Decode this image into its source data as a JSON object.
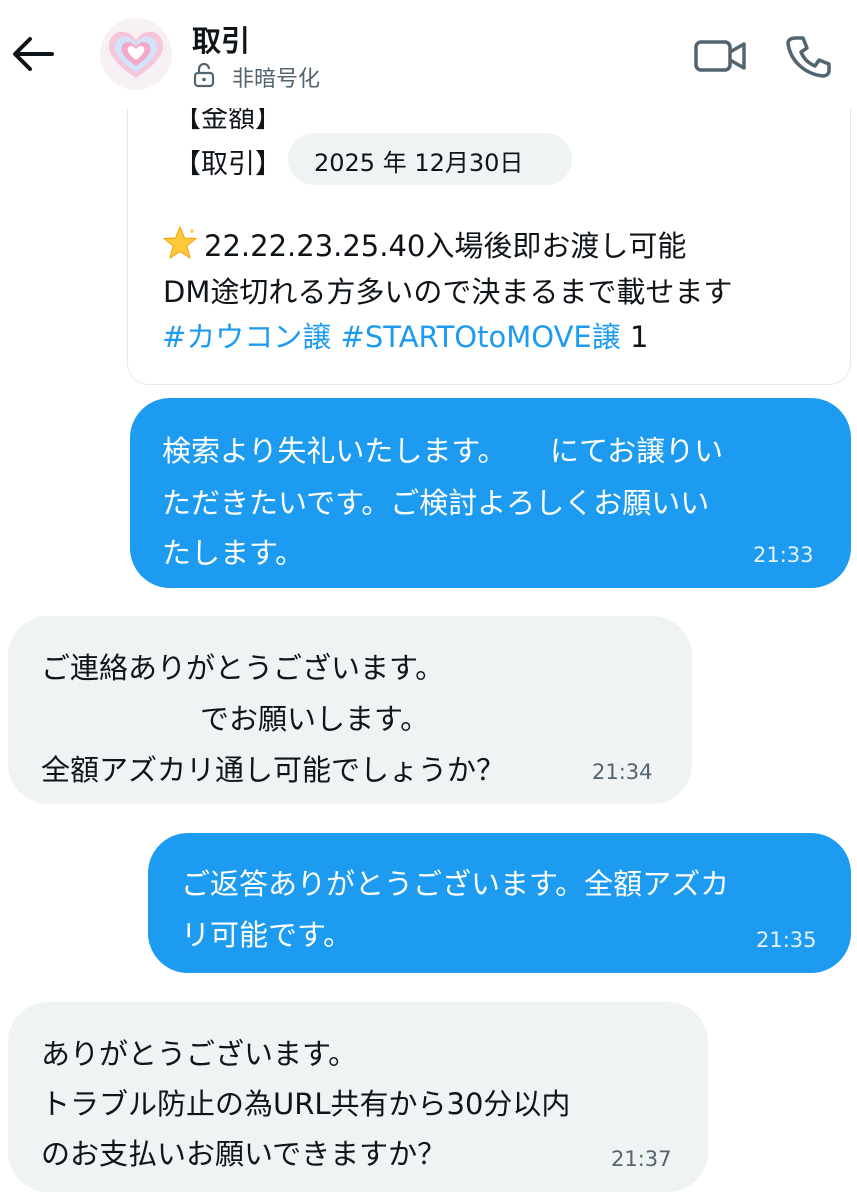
{
  "header": {
    "title": "取引",
    "subtitle": "非暗号化"
  },
  "shared_card": {
    "amount_label": "【金額】",
    "deal_label": "【取引】",
    "date": "2025 年 12月30日",
    "lines": [
      "22.22.23.25.40入場後即お渡し可能",
      "DM途切れる方多いので決まるまで載せます"
    ],
    "hashtags": [
      "#カウコン譲",
      "#STARTOtoMOVE譲"
    ],
    "trailing_text": "1"
  },
  "messages": [
    {
      "direction": "out",
      "lines": [
        "検索より失礼いたします。　　にてお譲りい",
        "ただきたいです。ご検討よろしくお願いい",
        "たします。"
      ],
      "time": "21:33"
    },
    {
      "direction": "in",
      "lines": [
        "ご連絡ありがとうございます。",
        "でお願いします。",
        "全額アズカリ通し可能でしょうか？"
      ],
      "time": "21:34"
    },
    {
      "direction": "out",
      "lines": [
        "ご返答ありがとうございます。全額アズカ",
        "リ可能です。"
      ],
      "time": "21:35"
    },
    {
      "direction": "in",
      "lines": [
        "ありがとうございます。",
        "トラブル防止の為URL共有から30分以内",
        "のお支払いお願いできますか？"
      ],
      "time": "21:37"
    }
  ],
  "colors": {
    "accent": "#1d9bf0",
    "incoming_bubble": "#eff3f4",
    "secondary_text": "#536471"
  },
  "icons": [
    "back-arrow-icon",
    "lock-icon",
    "video-call-icon",
    "phone-icon",
    "star-emoji-icon"
  ]
}
